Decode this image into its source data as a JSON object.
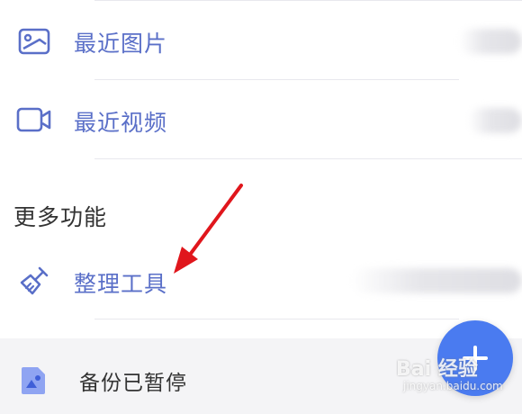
{
  "menu": {
    "recent_photos": {
      "label": "最近图片",
      "icon": "image-icon"
    },
    "recent_videos": {
      "label": "最近视频",
      "icon": "video-icon"
    }
  },
  "more_features": {
    "title": "更多功能",
    "cleanup_tool": {
      "label": "整理工具",
      "icon": "broom-icon"
    }
  },
  "bottom_bar": {
    "status": "备份已暂停",
    "icon": "backup-image-icon"
  },
  "fab": {
    "icon": "plus-icon"
  },
  "watermark": {
    "text": "Bai 经验",
    "subtext": "jingyan.baidu.com"
  },
  "colors": {
    "accent": "#5a6fc8",
    "fab": "#4a7bf0",
    "arrow": "#e0161c"
  }
}
